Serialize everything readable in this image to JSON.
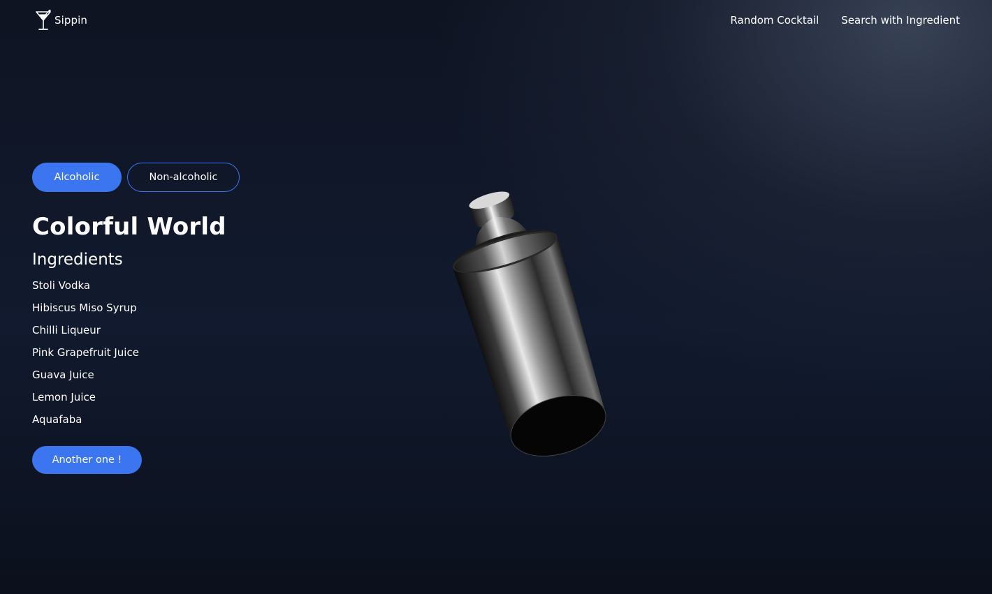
{
  "header": {
    "brand_icon": "cocktail-glass-icon",
    "brand_name": "Sippin",
    "nav": [
      {
        "label": "Random Cocktail"
      },
      {
        "label": "Search with Ingredient"
      }
    ]
  },
  "filters": {
    "selected": "Alcoholic",
    "options": [
      {
        "label": "Alcoholic"
      },
      {
        "label": "Non-alcoholic"
      }
    ]
  },
  "cocktail": {
    "name": "Colorful World",
    "ingredients_heading": "Ingredients",
    "ingredients": [
      "Stoli Vodka",
      "Hibiscus Miso Syrup",
      "Chilli Liqueur",
      "Pink Grapefruit Juice",
      "Guava Juice",
      "Lemon Juice",
      "Aquafaba"
    ],
    "another_button": "Another one !"
  },
  "visual": {
    "hero_image": "cocktail-shaker-3d",
    "accent_color": "#3b75f0",
    "background_color": "#111a2e"
  }
}
